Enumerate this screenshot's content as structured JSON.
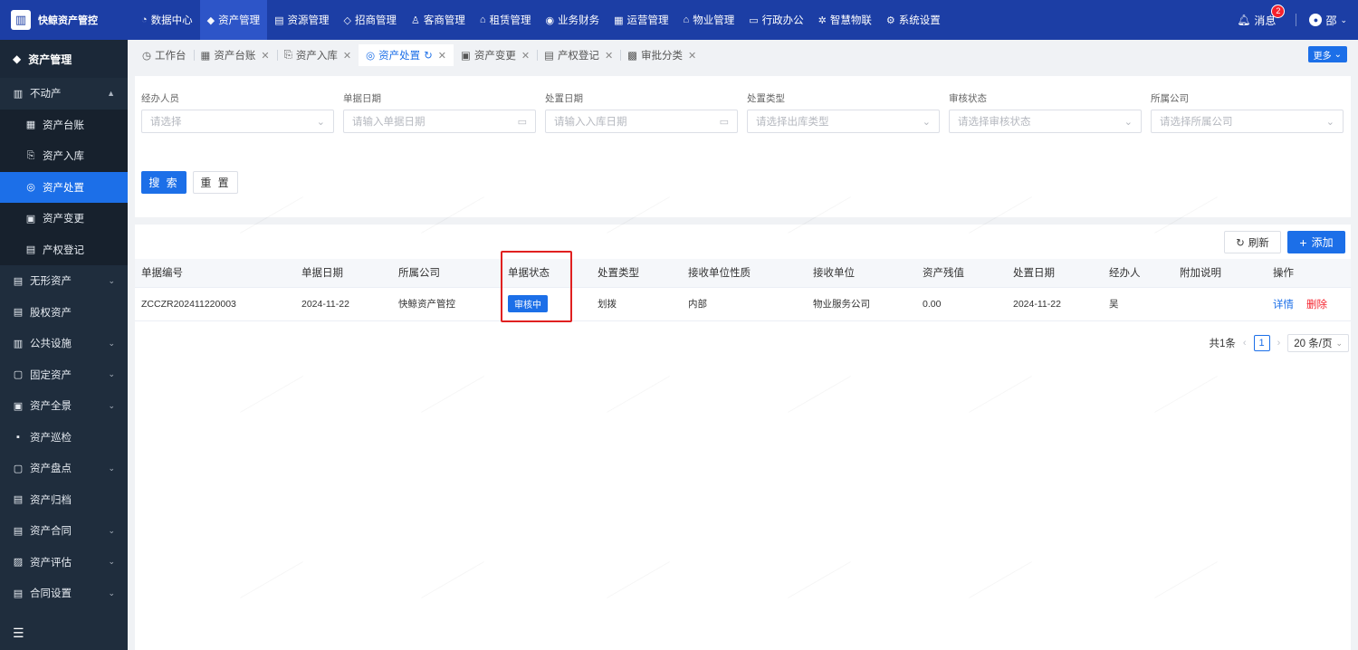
{
  "brand": {
    "name": "快鲸资产管控",
    "logo_icon": "building-icon"
  },
  "topnav": [
    {
      "label": "数据中心",
      "icon": "◔",
      "active": false
    },
    {
      "label": "资产管理",
      "icon": "◆",
      "active": true
    },
    {
      "label": "资源管理",
      "icon": "▤",
      "active": false
    },
    {
      "label": "招商管理",
      "icon": "◇",
      "active": false
    },
    {
      "label": "客商管理",
      "icon": "♙",
      "active": false
    },
    {
      "label": "租赁管理",
      "icon": "⌂",
      "active": false
    },
    {
      "label": "业务财务",
      "icon": "◉",
      "active": false
    },
    {
      "label": "运营管理",
      "icon": "▦",
      "active": false
    },
    {
      "label": "物业管理",
      "icon": "⌂",
      "active": false
    },
    {
      "label": "行政办公",
      "icon": "▭",
      "active": false
    },
    {
      "label": "智慧物联",
      "icon": "✲",
      "active": false
    },
    {
      "label": "系统设置",
      "icon": "⚙",
      "active": false
    }
  ],
  "top_right": {
    "message_label": "消息",
    "message_count": "2",
    "user_name": "邵"
  },
  "sidebar": {
    "title": "资产管理",
    "items": [
      {
        "label": "不动产",
        "icon": "▥",
        "chev": "▲",
        "sub": false
      },
      {
        "label": "资产台账",
        "icon": "▦",
        "chev": "",
        "sub": true,
        "active": false
      },
      {
        "label": "资产入库",
        "icon": "⎘",
        "chev": "",
        "sub": true,
        "active": false
      },
      {
        "label": "资产处置",
        "icon": "◎",
        "chev": "",
        "sub": true,
        "active": true
      },
      {
        "label": "资产变更",
        "icon": "▣",
        "chev": "",
        "sub": true,
        "active": false
      },
      {
        "label": "产权登记",
        "icon": "▤",
        "chev": "",
        "sub": true,
        "active": false
      },
      {
        "label": "无形资产",
        "icon": "▤",
        "chev": "⌄",
        "sub": false
      },
      {
        "label": "股权资产",
        "icon": "▤",
        "chev": "",
        "sub": false
      },
      {
        "label": "公共设施",
        "icon": "▥",
        "chev": "⌄",
        "sub": false
      },
      {
        "label": "固定资产",
        "icon": "▢",
        "chev": "⌄",
        "sub": false
      },
      {
        "label": "资产全景",
        "icon": "▣",
        "chev": "⌄",
        "sub": false
      },
      {
        "label": "资产巡检",
        "icon": "▪",
        "chev": "",
        "sub": false
      },
      {
        "label": "资产盘点",
        "icon": "▢",
        "chev": "⌄",
        "sub": false
      },
      {
        "label": "资产归档",
        "icon": "▤",
        "chev": "",
        "sub": false
      },
      {
        "label": "资产合同",
        "icon": "▤",
        "chev": "⌄",
        "sub": false
      },
      {
        "label": "资产评估",
        "icon": "▨",
        "chev": "⌄",
        "sub": false
      },
      {
        "label": "合同设置",
        "icon": "▤",
        "chev": "⌄",
        "sub": false
      }
    ]
  },
  "tabs": [
    {
      "label": "工作台",
      "icon": "◷",
      "closable": false,
      "active": false
    },
    {
      "label": "资产台账",
      "icon": "▦",
      "closable": true,
      "active": false
    },
    {
      "label": "资产入库",
      "icon": "⎘",
      "closable": true,
      "active": false
    },
    {
      "label": "资产处置",
      "icon": "◎",
      "closable": true,
      "active": true
    },
    {
      "label": "资产变更",
      "icon": "▣",
      "closable": true,
      "active": false
    },
    {
      "label": "产权登记",
      "icon": "▤",
      "closable": true,
      "active": false
    },
    {
      "label": "审批分类",
      "icon": "▩",
      "closable": true,
      "active": false
    }
  ],
  "more_label": "更多",
  "filters": [
    {
      "label": "经办人员",
      "placeholder": "请选择",
      "type": "select"
    },
    {
      "label": "单据日期",
      "placeholder": "请输入单据日期",
      "type": "date"
    },
    {
      "label": "处置日期",
      "placeholder": "请输入入库日期",
      "type": "date"
    },
    {
      "label": "处置类型",
      "placeholder": "请选择出库类型",
      "type": "select"
    },
    {
      "label": "审核状态",
      "placeholder": "请选择审核状态",
      "type": "select"
    },
    {
      "label": "所属公司",
      "placeholder": "请选择所属公司",
      "type": "select"
    }
  ],
  "buttons": {
    "search": "搜 索",
    "reset": "重 置",
    "refresh": "刷新",
    "add": "添加"
  },
  "table": {
    "columns": [
      "单据编号",
      "单据日期",
      "所属公司",
      "单据状态",
      "处置类型",
      "接收单位性质",
      "接收单位",
      "资产残值",
      "处置日期",
      "经办人",
      "附加说明",
      "操作"
    ],
    "rows": [
      {
        "no": "ZCCZR202411220003",
        "date": "2024-11-22",
        "company": "快鲸资产管控",
        "status": "审核中",
        "type": "划拨",
        "recv_nature": "内部",
        "recv_unit": "物业服务公司",
        "residual": "0.00",
        "dispose_date": "2024-11-22",
        "handler": "吴",
        "note": "",
        "op_detail": "详情",
        "op_delete": "删除"
      }
    ]
  },
  "pager": {
    "total": "共1条",
    "page": "1",
    "size": "20 条/页"
  },
  "colors": {
    "topbar": "#1c3ea5",
    "primary": "#1c6fe8",
    "sidebar": "#1f2d3d",
    "danger": "#f5222d",
    "highlight": "#e02020"
  }
}
